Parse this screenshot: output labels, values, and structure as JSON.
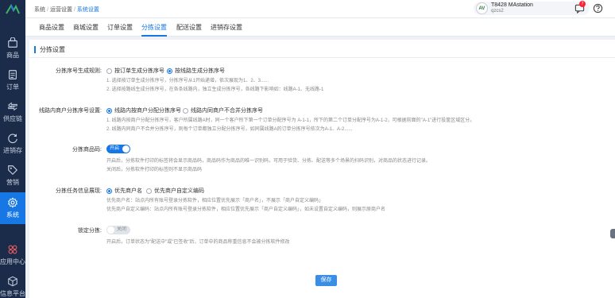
{
  "sidebar": {
    "items": [
      {
        "label": "商品",
        "icon": "bag-icon"
      },
      {
        "label": "订单",
        "icon": "order-icon"
      },
      {
        "label": "供应链",
        "icon": "supply-chain-icon"
      },
      {
        "label": "进销存",
        "icon": "inventory-icon"
      },
      {
        "label": "营销",
        "icon": "tag-icon"
      },
      {
        "label": "系统",
        "icon": "gear-icon",
        "active": true
      },
      {
        "label": "应用中心",
        "icon": "apps-icon"
      },
      {
        "label": "信息平台",
        "icon": "cube-icon"
      }
    ]
  },
  "header": {
    "breadcrumb": [
      "系统",
      "运营设置",
      "系统设置"
    ],
    "user_name": "T8428 MAstation",
    "user_sub": "qzcs2",
    "avatar_text": "AV",
    "notification_count": "7"
  },
  "tabs": [
    "商品设置",
    "商城设置",
    "订单设置",
    "分拣设置",
    "配送设置",
    "进销存设置"
  ],
  "active_tab": "分拣设置",
  "section_title": "分拣设置",
  "settings": {
    "sort_number": {
      "label": "分拣序号生成规则:",
      "options": [
        "按订单生成分拣序号",
        "按线路生成分拣序号"
      ],
      "selected": 1,
      "desc": [
        "1. 选择按订单生成分拣序号，分拣序号从1开始递增，依次展现为1、2、3......",
        "2. 选择按路线生成分拣序号，在各条线路内，独立生成分拣序号，各线路下影响如：线路A-1、无线路-1"
      ]
    },
    "route_merchant": {
      "label": "线路内商户分拣序号设置:",
      "options": [
        "线路内按商户分配分拣序号",
        "线路内同商户不合并分拣序号"
      ],
      "selected": 0,
      "desc": [
        "1. 线路内按商户分配分拣序号，客户所属线路A时，同一个客户所下第一个订单分配序号为 A-1-1，所下的第二个订单分配序号为A-1-2，可根据前面的\"A-1\"进行投筐区域区分。",
        "2. 线路内同商户不合并分拣序号，则每个订单都独立分配分拣序号，如同属线路A的订单分拣序号依次为A-1、A-2......"
      ]
    },
    "sort_code": {
      "label": "分拣商品码:",
      "switch_text": "开启",
      "desc": [
        "开启后，分拣软件打印的标签将会显示商品码，商品码作为商品的唯一识别码，可用于验货、分拣、配送等多个场景的扫码识别，对商品的状态进行记录。",
        "关闭后，分拣软件打印的标签则不显示商品码"
      ]
    },
    "task_info": {
      "label": "分拣任务信息展现:",
      "options": [
        "优先商户名",
        "优先商户自定义编码"
      ],
      "selected": 0,
      "desc": [
        "优先商户名：站点内所有账号登录分拣软件，相应位置优先展示「商户名」，不展示「商户自定义编码」",
        "优先商户自定义编码：站点内所有账号登录分拣软件，相应位置优先展示「商户自定义编码」，如未设置自定义编码，则展示原商户名"
      ]
    },
    "lock_sort": {
      "label": "锁定分拣:",
      "switch_text": "关闭",
      "desc": [
        "开启后，订单状态为\"配送中\"或\"已签收\"后，订单中的商品称重信息不会被分拣软件修改"
      ]
    }
  },
  "save_label": "保存"
}
